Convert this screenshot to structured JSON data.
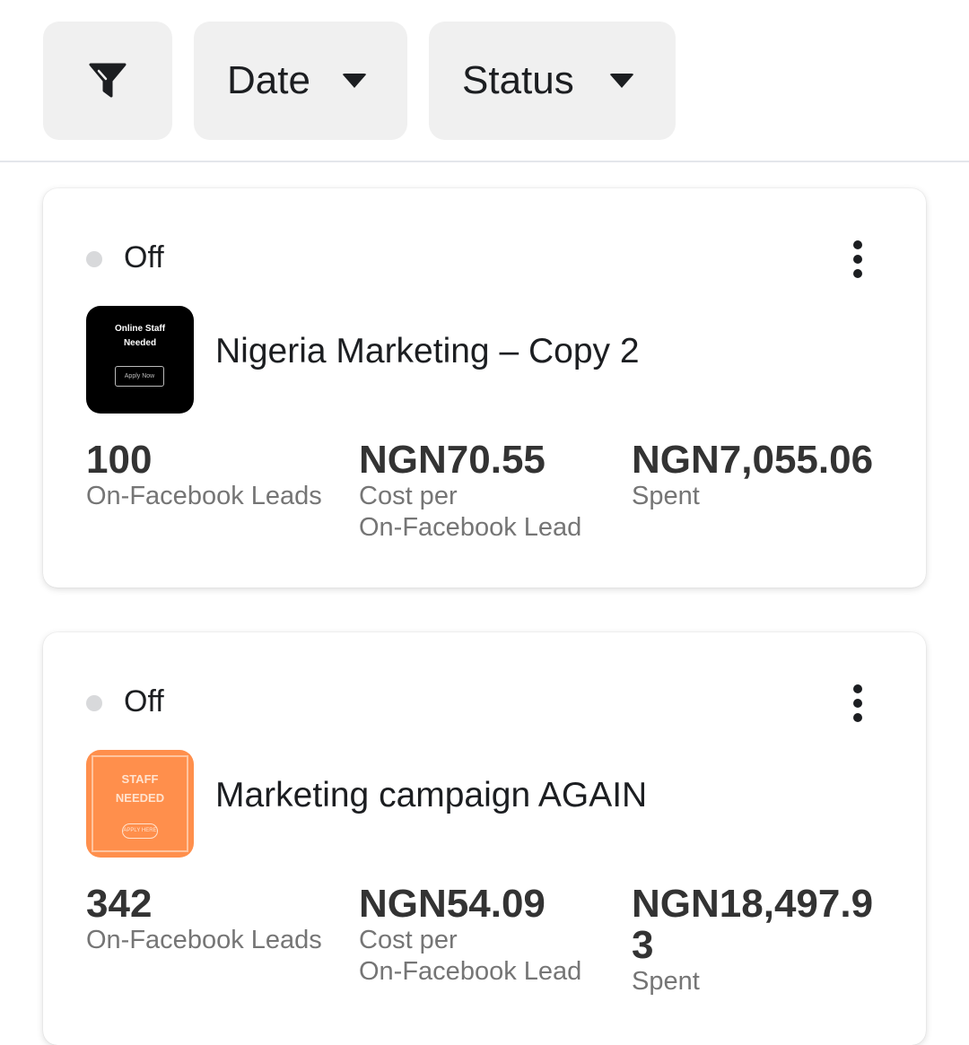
{
  "filters": {
    "filter_icon": "funnel-icon",
    "date_label": "Date",
    "status_label": "Status",
    "caret_icon": "caret-down-icon"
  },
  "colors": {
    "chip_bg": "#f0f0f0",
    "status_off_dot": "#d8d9db",
    "metric_value": "#333333",
    "metric_label": "#757575"
  },
  "ads": [
    {
      "status": "Off",
      "name": "Nigeria Marketing – Copy 2",
      "thumbnail": {
        "title": "Online Staff\nNeeded",
        "button": "Apply Now"
      },
      "metrics": [
        {
          "value": "100",
          "label": "On-Facebook Leads"
        },
        {
          "value": "NGN70.55",
          "label": "Cost per\nOn-Facebook Lead"
        },
        {
          "value": "NGN7,055.06",
          "label": "Spent"
        }
      ]
    },
    {
      "status": "Off",
      "name": "Marketing campaign AGAIN",
      "thumbnail": {
        "title": "STAFF\nNEEDED",
        "button": "APPLY HERE"
      },
      "metrics": [
        {
          "value": "342",
          "label": "On-Facebook Leads"
        },
        {
          "value": "NGN54.09",
          "label": "Cost per\nOn-Facebook Lead"
        },
        {
          "value": "NGN18,497.93",
          "label": "Spent"
        }
      ]
    }
  ]
}
